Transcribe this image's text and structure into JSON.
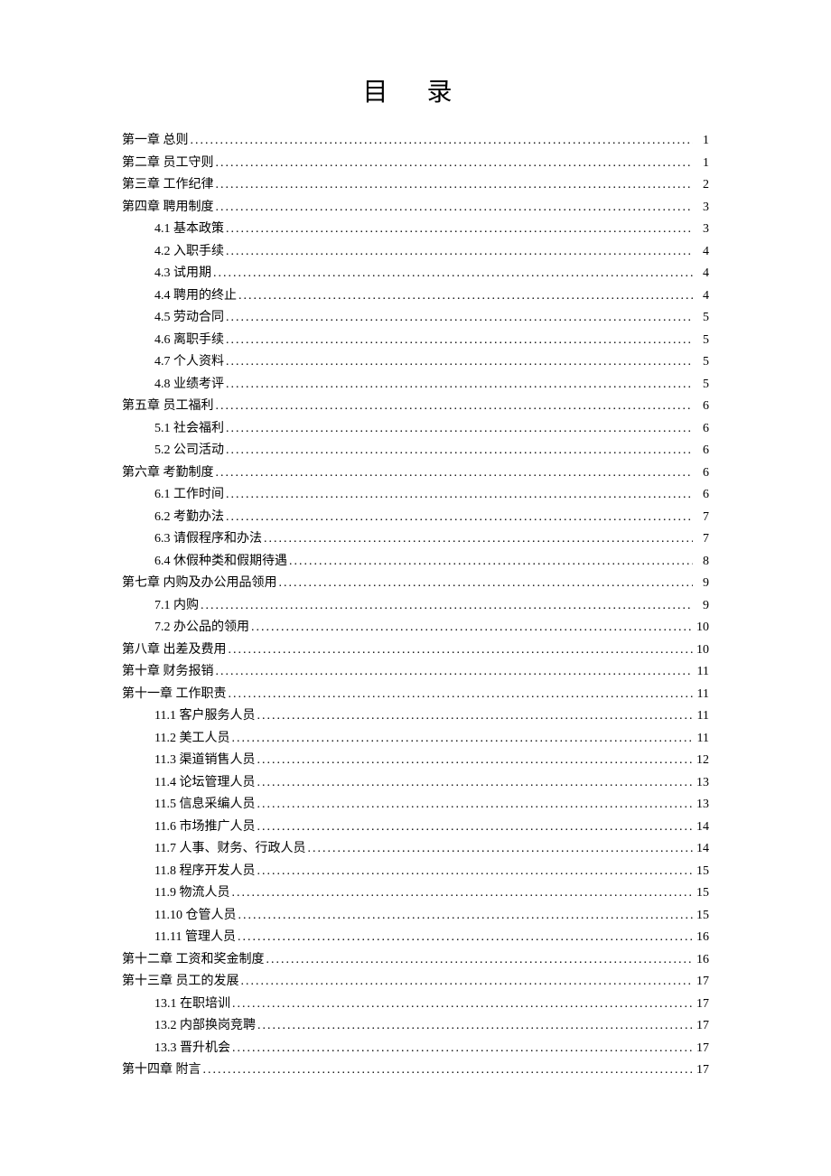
{
  "title": "目 录",
  "entries": [
    {
      "level": 1,
      "label": "第一章  总则",
      "page": "1"
    },
    {
      "level": 1,
      "label": "第二章  员工守则",
      "page": "1"
    },
    {
      "level": 1,
      "label": "第三章  工作纪律",
      "page": "2"
    },
    {
      "level": 1,
      "label": "第四章  聘用制度",
      "page": "3"
    },
    {
      "level": 2,
      "label": "4.1  基本政策",
      "page": "3"
    },
    {
      "level": 2,
      "label": "4.2  入职手续",
      "page": "4"
    },
    {
      "level": 2,
      "label": "4.3  试用期",
      "page": "4"
    },
    {
      "level": 2,
      "label": "4.4  聘用的终止",
      "page": "4"
    },
    {
      "level": 2,
      "label": "4.5  劳动合同",
      "page": "5"
    },
    {
      "level": 2,
      "label": "4.6  离职手续",
      "page": "5"
    },
    {
      "level": 2,
      "label": "4.7  个人资料",
      "page": "5"
    },
    {
      "level": 2,
      "label": "4.8  业绩考评",
      "page": "5"
    },
    {
      "level": 1,
      "label": "第五章  员工福利",
      "page": "6"
    },
    {
      "level": 2,
      "label": "5.1  社会福利",
      "page": "6"
    },
    {
      "level": 2,
      "label": "5.2  公司活动",
      "page": "6"
    },
    {
      "level": 1,
      "label": "第六章  考勤制度",
      "page": "6"
    },
    {
      "level": 2,
      "label": "6.1  工作时间",
      "page": "6"
    },
    {
      "level": 2,
      "label": "6.2  考勤办法",
      "page": "7"
    },
    {
      "level": 2,
      "label": "6.3  请假程序和办法",
      "page": "7"
    },
    {
      "level": 2,
      "label": "6.4  休假种类和假期待遇",
      "page": "8"
    },
    {
      "level": 1,
      "label": "第七章  内购及办公用品领用",
      "page": "9"
    },
    {
      "level": 2,
      "label": "7.1  内购",
      "page": "9"
    },
    {
      "level": 2,
      "label": "7.2  办公品的领用",
      "page": "10"
    },
    {
      "level": 1,
      "label": "第八章  出差及费用",
      "page": "10"
    },
    {
      "level": 1,
      "label": "第十章  财务报销",
      "page": "11"
    },
    {
      "level": 1,
      "label": "第十一章  工作职责",
      "page": "11"
    },
    {
      "level": 2,
      "label": "11.1  客户服务人员",
      "page": "11"
    },
    {
      "level": 2,
      "label": "11.2  美工人员",
      "page": "11"
    },
    {
      "level": 2,
      "label": "11.3  渠道销售人员",
      "page": "12"
    },
    {
      "level": 2,
      "label": "11.4  论坛管理人员",
      "page": "13"
    },
    {
      "level": 2,
      "label": "11.5  信息采编人员",
      "page": "13"
    },
    {
      "level": 2,
      "label": "11.6  市场推广人员",
      "page": "14"
    },
    {
      "level": 2,
      "label": "11.7  人事、财务、行政人员",
      "page": "14"
    },
    {
      "level": 2,
      "label": "11.8  程序开发人员",
      "page": "15"
    },
    {
      "level": 2,
      "label": "11.9  物流人员",
      "page": "15"
    },
    {
      "level": 2,
      "label": "11.10  仓管人员",
      "page": "15"
    },
    {
      "level": 2,
      "label": "11.11  管理人员",
      "page": "16"
    },
    {
      "level": 1,
      "label": "第十二章  工资和奖金制度",
      "page": "16"
    },
    {
      "level": 1,
      "label": "第十三章  员工的发展",
      "page": "17"
    },
    {
      "level": 2,
      "label": "13.1  在职培训",
      "page": "17"
    },
    {
      "level": 2,
      "label": "13.2  内部换岗竞聘",
      "page": "17"
    },
    {
      "level": 2,
      "label": "13.3  晋升机会",
      "page": "17"
    },
    {
      "level": 1,
      "label": "第十四章  附言",
      "page": "17"
    }
  ]
}
